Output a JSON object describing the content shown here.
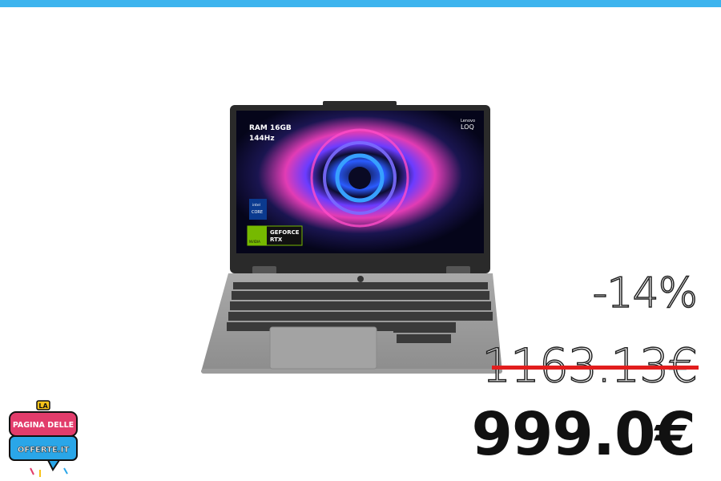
{
  "header": {
    "accent_color": "#3db4ee"
  },
  "product": {
    "image_name": "laptop-lenovo-loq",
    "screen": {
      "spec_line1": "RAM 16GB",
      "spec_line2": "144Hz",
      "brand_small": "Lenovo",
      "brand_large": "LOQ",
      "cpu_badge_top": "intel",
      "cpu_badge_mid": "CORE",
      "gpu_badge_l1": "GEFORCE",
      "gpu_badge_l2": "RTX",
      "gpu_badge_brand": "NVIDIA"
    }
  },
  "pricing": {
    "discount": "-14%",
    "old_price": "1163.13€",
    "new_price": "999.0€",
    "strike_color": "#e21d1d"
  },
  "brand_logo": {
    "line1": "LA",
    "line2": "PAGINA DELLE",
    "line3": "OFFERTE.IT"
  }
}
